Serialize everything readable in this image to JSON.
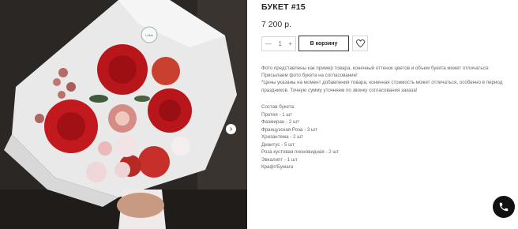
{
  "product": {
    "title": "БУКЕТ #15",
    "price": "7 200 р.",
    "brand_logo_text": "Lolita"
  },
  "quantity": {
    "minus": "—",
    "value": "1",
    "plus": "+"
  },
  "buttons": {
    "add_to_cart": "В корзину"
  },
  "icons": {
    "favorite": "heart-icon",
    "gallery_next": "chevron-right-icon",
    "call": "phone-icon"
  },
  "description": {
    "line1": "Фото представлены как пример товара, конечный оттенок цветов и объем букета может отличаться. Присылаем фото букета на согласование!",
    "line2": "*Цены указаны на момент добавления товара, конечная стоимость может отличаться, особенно в период праздников. Точную сумму уточняем по звонку согласования заказа!"
  },
  "composition": {
    "heading": "Состав букета:",
    "items": [
      "Протея - 1 шт",
      "Фаэмиран - 2 шт",
      "Французская Роза - 3 шт",
      "Хризантема - 2 шт",
      "Диантус - 5 шт",
      "Роза кустовая пионовидная - 2 шт",
      "Эвкалипт - 1 шт",
      "Крафт/Бумага"
    ]
  },
  "gallery": {
    "next_arrow": "›"
  },
  "colors": {
    "accent": "#b31015",
    "background": "#2a2623",
    "wrap": "#ececec"
  }
}
